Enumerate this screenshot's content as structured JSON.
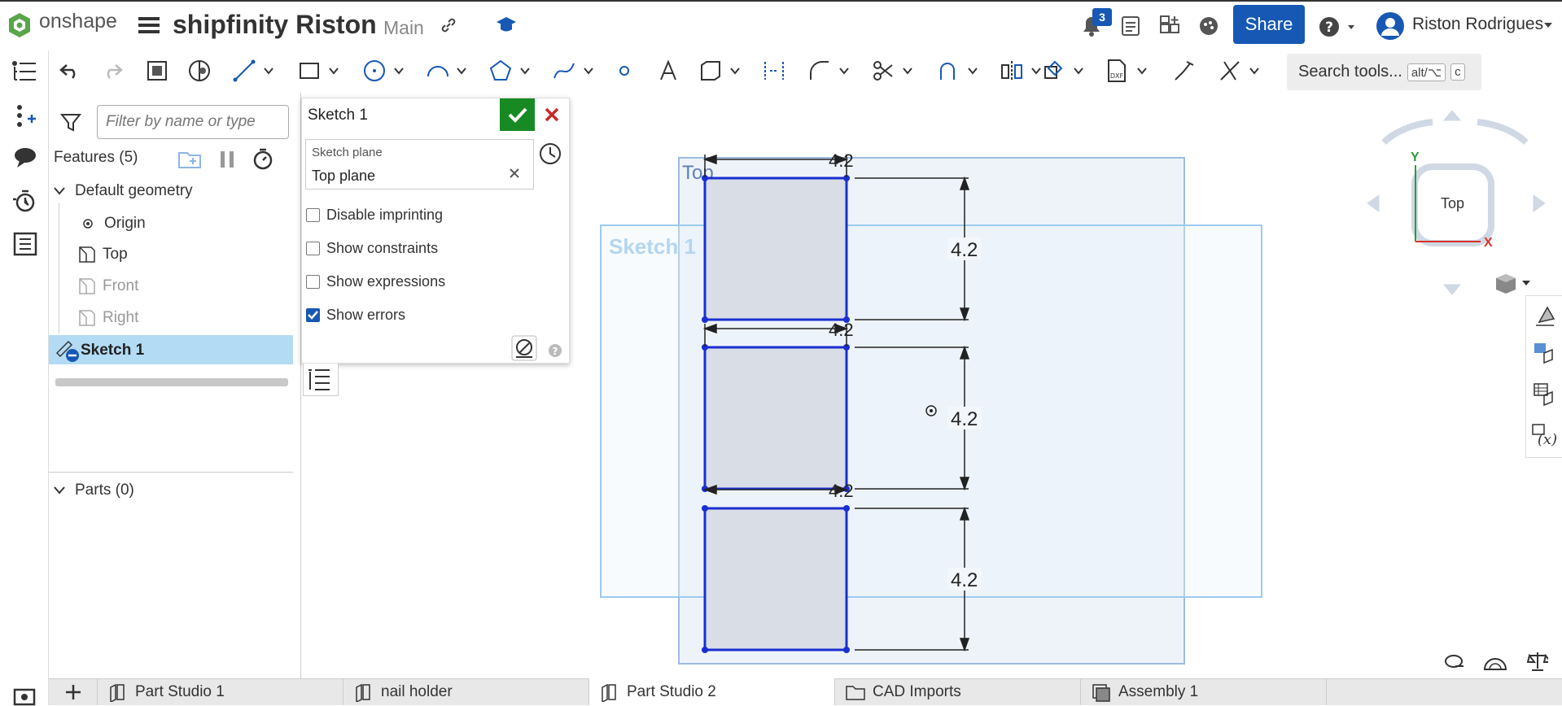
{
  "app": {
    "logo_text": "onshape"
  },
  "document": {
    "title": "shipfinity Riston",
    "branch": "Main"
  },
  "header": {
    "share_label": "Share",
    "user_name": "Riston Rodrigues",
    "notification_count": "3"
  },
  "toolbar": {
    "search_label": "Search tools...",
    "search_key1": "alt/⌥",
    "search_key2": "c"
  },
  "feature_panel": {
    "filter_placeholder": "Filter by name or type",
    "features_title": "Features (5)",
    "default_geometry_label": "Default geometry",
    "items": [
      {
        "label": "Origin"
      },
      {
        "label": "Top"
      },
      {
        "label": "Front"
      },
      {
        "label": "Right"
      }
    ],
    "sketch_label": "Sketch 1",
    "parts_label": "Parts (0)"
  },
  "sketch_dialog": {
    "title": "Sketch 1",
    "plane_label": "Sketch plane",
    "plane_value": "Top plane",
    "options": [
      {
        "label": "Disable imprinting",
        "checked": false
      },
      {
        "label": "Show constraints",
        "checked": false
      },
      {
        "label": "Show expressions",
        "checked": false
      },
      {
        "label": "Show errors",
        "checked": true
      }
    ]
  },
  "viewport": {
    "plane_top_label": "Top",
    "sketch_label": "Sketch 1",
    "dimensions": [
      "4.2",
      "4.2",
      "4.2",
      "4.2",
      "4.2",
      "4.2"
    ],
    "viewcube_face": "Top",
    "axis_x": "X",
    "axis_y": "Y"
  },
  "tabs": [
    {
      "label": "Part Studio 1",
      "active": false
    },
    {
      "label": "nail holder",
      "active": false
    },
    {
      "label": "Part Studio 2",
      "active": true
    },
    {
      "label": "CAD Imports",
      "active": false
    },
    {
      "label": "Assembly 1",
      "active": false
    }
  ],
  "colors": {
    "accent": "#1658b4",
    "sketch_blue": "#1a2fd0",
    "accept_green": "#178a23",
    "cancel_red": "#c62828",
    "selection": "#b3dbf3"
  }
}
